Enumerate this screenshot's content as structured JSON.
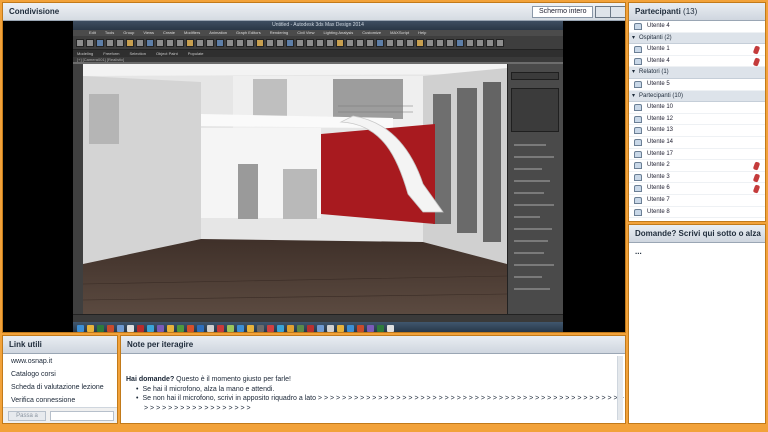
{
  "share": {
    "title": "Condivisione",
    "fullscreen_label": "Schermo intero",
    "app": {
      "title": "Untitled - Autodesk 3ds Max Design 2014",
      "menus": [
        "Edit",
        "Tools",
        "Group",
        "Views",
        "Create",
        "Modifiers",
        "Animation",
        "Graph Editors",
        "Rendering",
        "Civil View",
        "Lighting Analysis",
        "Customize",
        "MAXScript",
        "Help"
      ],
      "ribbon_tabs": [
        "Modeling",
        "Freeform",
        "Selection",
        "Object Paint",
        "Populate"
      ],
      "viewport_label": "[+] [Camera001] [Realistic]",
      "colors": {
        "wall": "#dcdcdc",
        "floor": "#4a3a33",
        "stair": "#a81a1f"
      }
    }
  },
  "participants": {
    "title": "Partecipanti",
    "count": "(13)",
    "top_user": "Utente 4",
    "groups": [
      {
        "label": "Ospitanti (2)",
        "users": [
          {
            "name": "Utente 1",
            "mic": true
          },
          {
            "name": "Utente 4",
            "mic": true
          }
        ]
      },
      {
        "label": "Relatori (1)",
        "users": [
          {
            "name": "Utente 5",
            "mic": false
          }
        ]
      },
      {
        "label": "Partecipanti (10)",
        "users": [
          {
            "name": "Utente 10",
            "mic": false
          },
          {
            "name": "Utente 12",
            "mic": false
          },
          {
            "name": "Utente 13",
            "mic": false
          },
          {
            "name": "Utente 14",
            "mic": false
          },
          {
            "name": "Utente 17",
            "mic": false
          },
          {
            "name": "Utente 2",
            "mic": true
          },
          {
            "name": "Utente 3",
            "mic": true
          },
          {
            "name": "Utente 6",
            "mic": true
          },
          {
            "name": "Utente 7",
            "mic": false
          },
          {
            "name": "Utente 8",
            "mic": false
          }
        ]
      }
    ]
  },
  "questions": {
    "title": "Domande? Scrivi qui sotto o alza ..."
  },
  "links": {
    "title": "Link utili",
    "items": [
      "www.osnap.it",
      "Catalogo corsi",
      "Scheda di valutazione lezione",
      "Verifica connessione"
    ],
    "go_button": "Passa a"
  },
  "notes": {
    "title": "Note per iteragire",
    "lead_bold": "Hai domande?",
    "lead_text": " Questo è il momento giusto per farle!",
    "bullets": [
      "Se hai il microfono, alza la mano e attendi.",
      "Se non hai il microfono, scrivi in apposito riquadro a lato > > > > > > > > > > > > > > > > > > > > > > > > > > > > > > > > > > > > > > > > > > > > > > > > > > > > > > > > > > > > > > > > > > > > >"
    ]
  }
}
